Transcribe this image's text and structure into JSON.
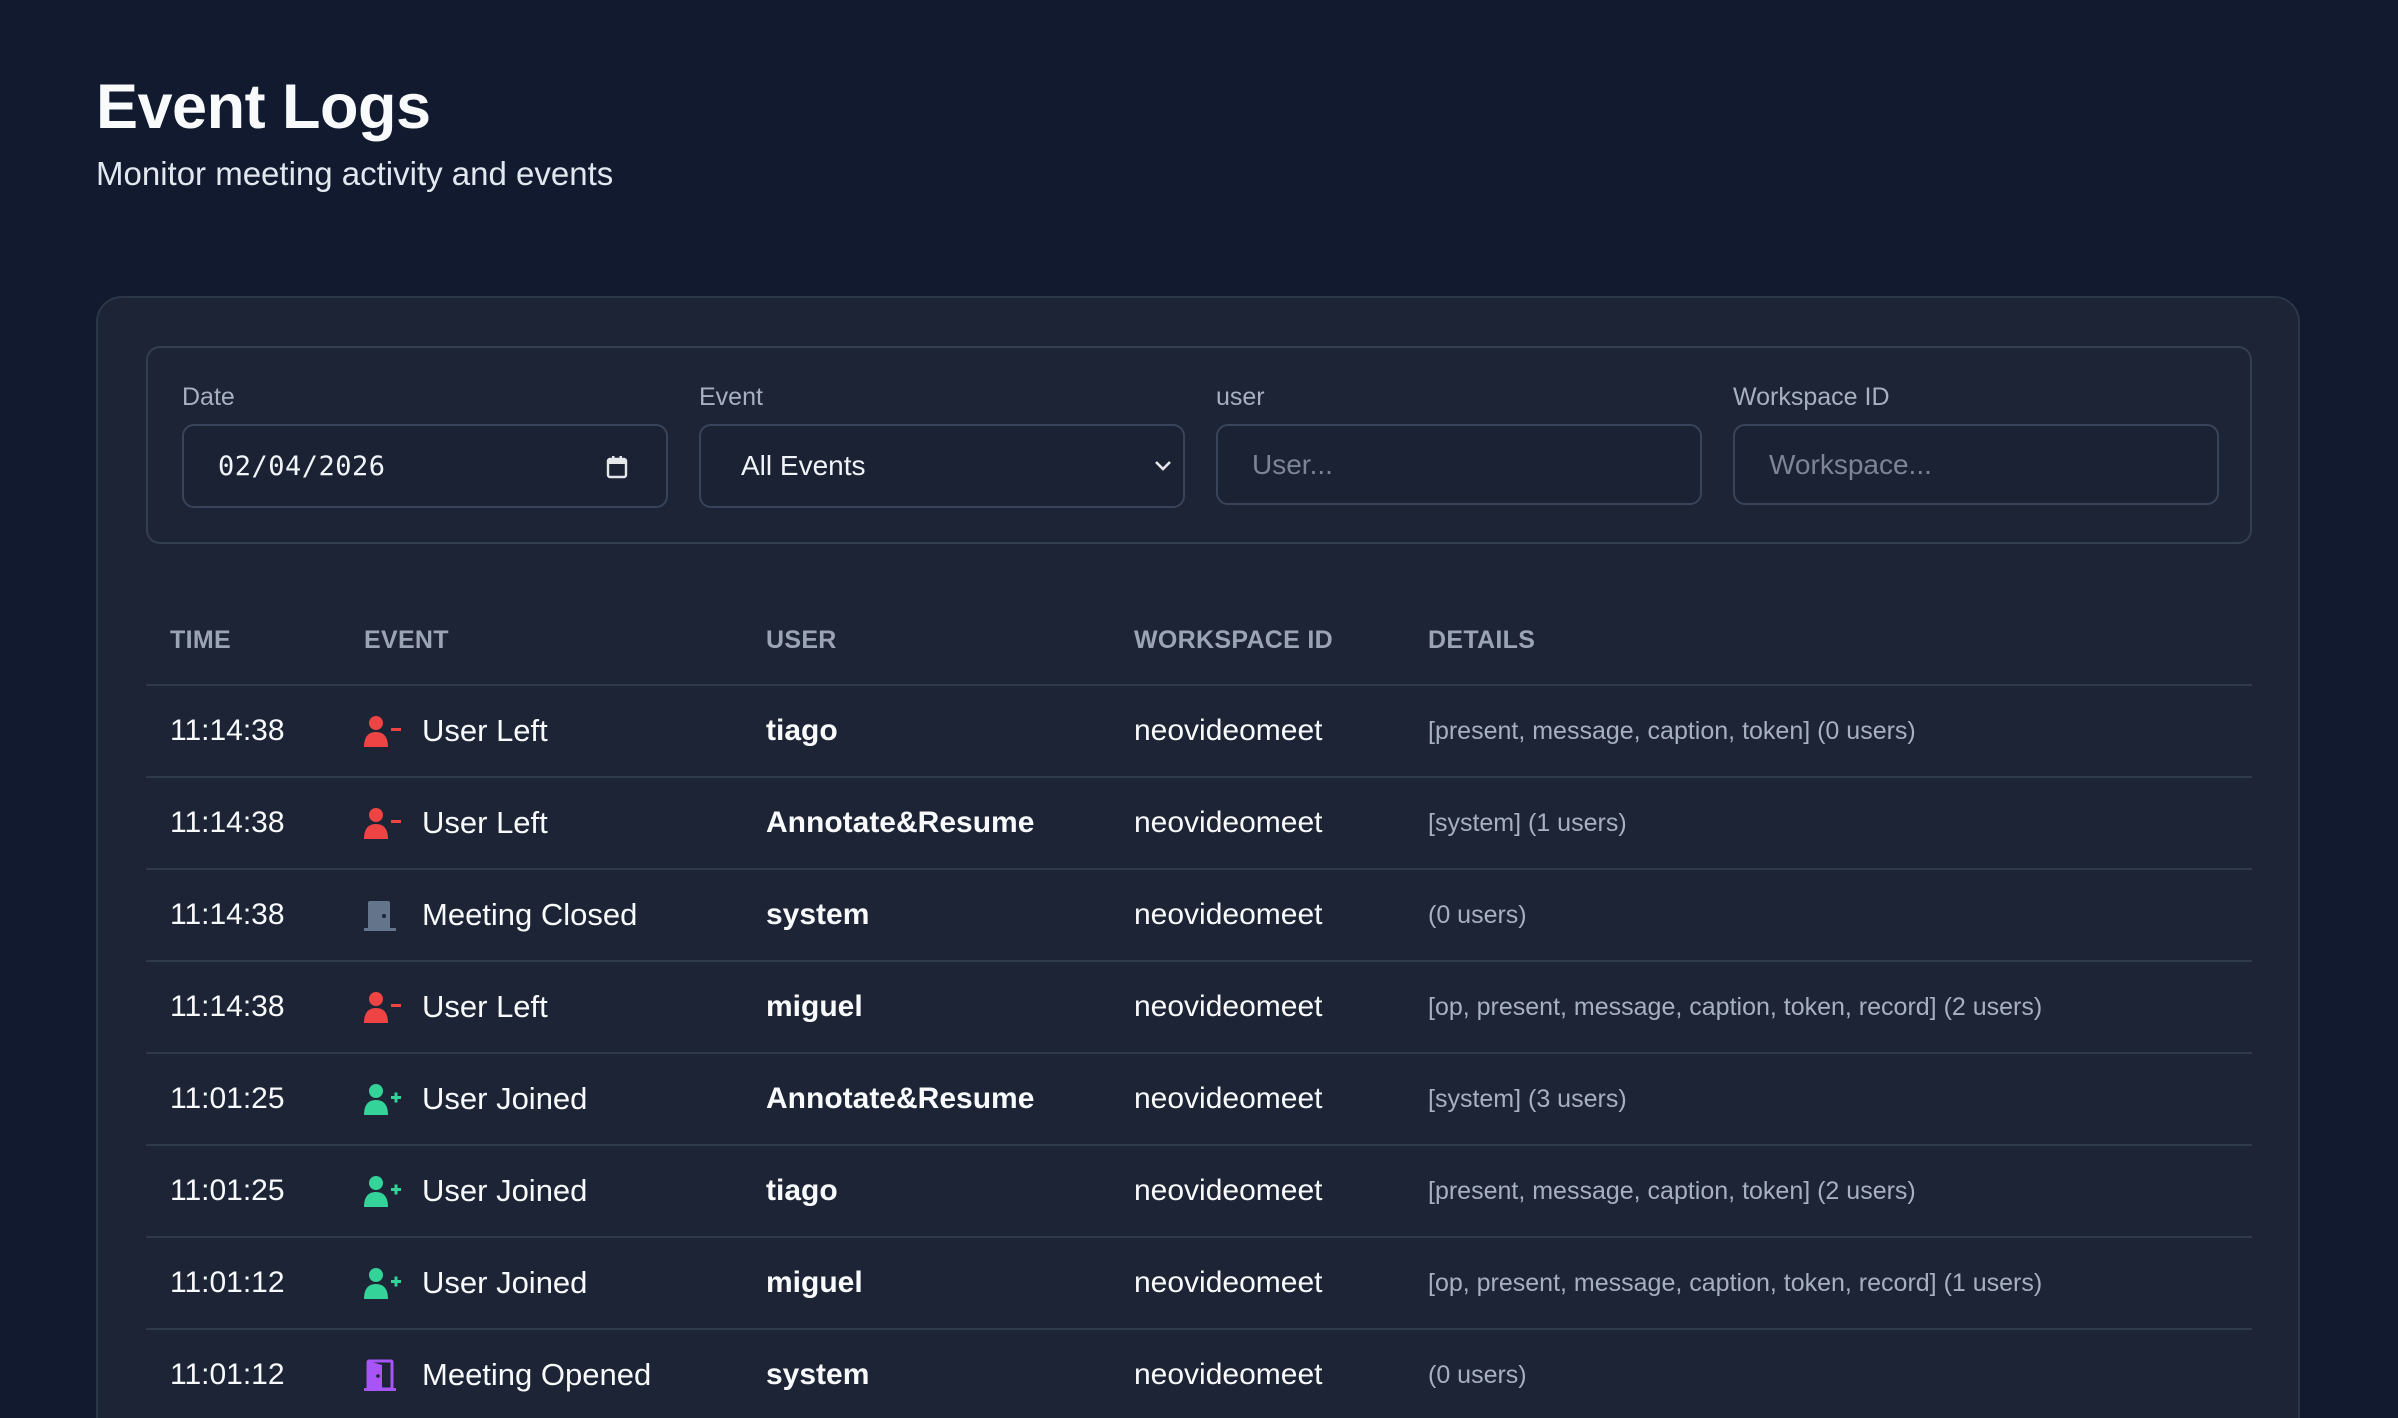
{
  "header": {
    "title": "Event Logs",
    "subtitle": "Monitor meeting activity and events"
  },
  "filters": {
    "date": {
      "label": "Date",
      "value": "02/04/2026"
    },
    "event": {
      "label": "Event",
      "value": "All Events"
    },
    "user": {
      "label": "user",
      "placeholder": "User..."
    },
    "workspace": {
      "label": "Workspace ID",
      "placeholder": "Workspace..."
    }
  },
  "table": {
    "columns": [
      "TIME",
      "EVENT",
      "USER",
      "WORKSPACE ID",
      "DETAILS"
    ],
    "rows": [
      {
        "time": "11:14:38",
        "event": "User Left",
        "icon": "user-minus-icon",
        "user": "tiago",
        "workspace": "neovideomeet",
        "details": "[present, message, caption, token] (0 users)"
      },
      {
        "time": "11:14:38",
        "event": "User Left",
        "icon": "user-minus-icon",
        "user": "Annotate&Resume",
        "workspace": "neovideomeet",
        "details": "[system] (1 users)"
      },
      {
        "time": "11:14:38",
        "event": "Meeting Closed",
        "icon": "door-closed-icon",
        "user": "system",
        "workspace": "neovideomeet",
        "details": "(0 users)"
      },
      {
        "time": "11:14:38",
        "event": "User Left",
        "icon": "user-minus-icon",
        "user": "miguel",
        "workspace": "neovideomeet",
        "details": "[op, present, message, caption, token, record] (2 users)"
      },
      {
        "time": "11:01:25",
        "event": "User Joined",
        "icon": "user-plus-icon",
        "user": "Annotate&Resume",
        "workspace": "neovideomeet",
        "details": "[system] (3 users)"
      },
      {
        "time": "11:01:25",
        "event": "User Joined",
        "icon": "user-plus-icon",
        "user": "tiago",
        "workspace": "neovideomeet",
        "details": "[present, message, caption, token] (2 users)"
      },
      {
        "time": "11:01:12",
        "event": "User Joined",
        "icon": "user-plus-icon",
        "user": "miguel",
        "workspace": "neovideomeet",
        "details": "[op, present, message, caption, token, record] (1 users)"
      },
      {
        "time": "11:01:12",
        "event": "Meeting Opened",
        "icon": "door-open-icon",
        "user": "system",
        "workspace": "neovideomeet",
        "details": "(0 users)"
      }
    ]
  },
  "colors": {
    "background": "#111a2e",
    "panel": "#1c2435",
    "user_left": "#ef4444",
    "user_joined": "#34d399",
    "meeting_closed": "#64748b",
    "meeting_opened": "#a855f7"
  }
}
